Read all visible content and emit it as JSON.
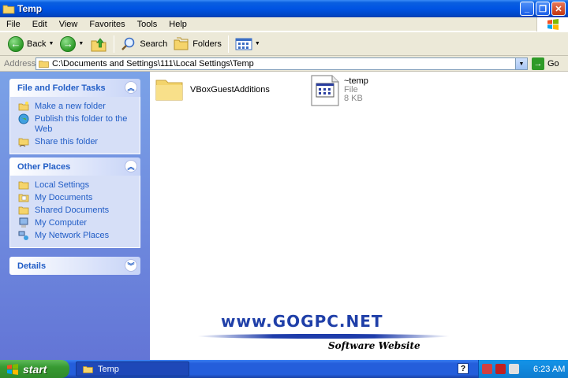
{
  "window": {
    "title": "Temp"
  },
  "menu": [
    "File",
    "Edit",
    "View",
    "Favorites",
    "Tools",
    "Help"
  ],
  "toolbar": {
    "back_label": "Back",
    "search_label": "Search",
    "folders_label": "Folders"
  },
  "address": {
    "label": "Address",
    "value": "C:\\Documents and Settings\\111\\Local Settings\\Temp",
    "go_label": "Go"
  },
  "sidebar": {
    "file_tasks": {
      "title": "File and Folder Tasks",
      "items": [
        "Make a new folder",
        "Publish this folder to the Web",
        "Share this folder"
      ]
    },
    "other_places": {
      "title": "Other Places",
      "items": [
        "Local Settings",
        "My Documents",
        "Shared Documents",
        "My Computer",
        "My Network Places"
      ]
    },
    "details": {
      "title": "Details"
    }
  },
  "files": [
    {
      "name": "VBoxGuestAdditions"
    },
    {
      "name": "~temp",
      "type": "File",
      "size": "8 KB"
    }
  ],
  "watermark": {
    "text": "www.GOGPC.NET",
    "subtitle": "Software Website"
  },
  "taskbar": {
    "start_label": "start",
    "task_label": "Temp",
    "clock": "6:23 AM"
  },
  "colors": {
    "accent": "#0054e3",
    "panel_link": "#215dc6",
    "start_green": "#379a32"
  }
}
